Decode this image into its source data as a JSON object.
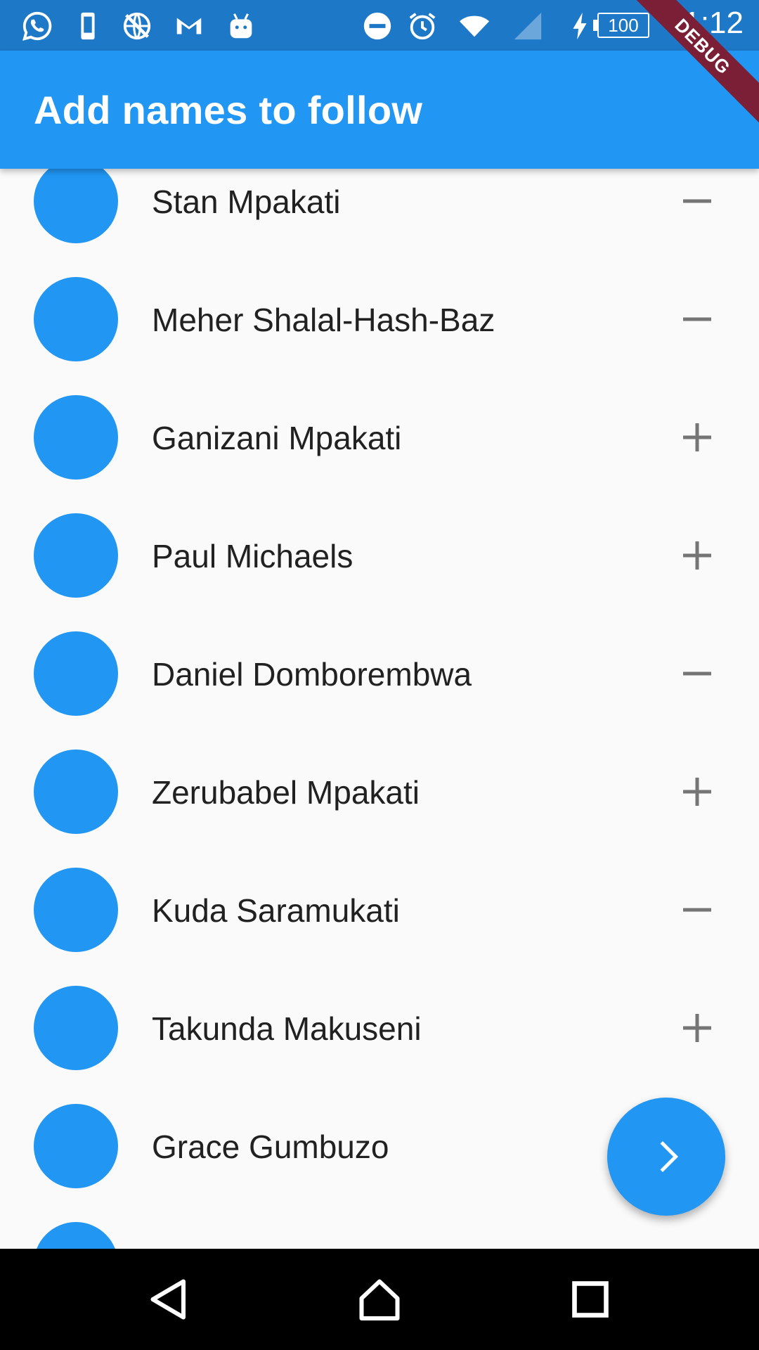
{
  "status_bar": {
    "time": "11:12",
    "battery": "100",
    "icons": [
      "whatsapp-icon",
      "phone-notification-icon",
      "no-network-icon",
      "gmail-icon",
      "android-icon",
      "do-not-disturb-icon",
      "alarm-icon",
      "wifi-icon",
      "cell-signal-icon",
      "charging-icon",
      "battery-icon"
    ]
  },
  "app_bar": {
    "title": "Add names to follow"
  },
  "debug_banner": "DEBUG",
  "list": {
    "items": [
      {
        "name": "Stan Mpakati",
        "action": "remove"
      },
      {
        "name": "Meher Shalal-Hash-Baz",
        "action": "remove"
      },
      {
        "name": "Ganizani Mpakati",
        "action": "add"
      },
      {
        "name": "Paul Michaels",
        "action": "add"
      },
      {
        "name": "Daniel Domborembwa",
        "action": "remove"
      },
      {
        "name": "Zerubabel Mpakati",
        "action": "add"
      },
      {
        "name": "Kuda Saramukati",
        "action": "remove"
      },
      {
        "name": "Takunda Makuseni",
        "action": "add"
      },
      {
        "name": "Grace Gumbuzo",
        "action": ""
      },
      {
        "name": "",
        "action": ""
      }
    ]
  },
  "fab": {
    "icon": "chevron-right-icon"
  },
  "nav_bar": {
    "buttons": [
      "back-icon",
      "home-icon",
      "recents-icon"
    ]
  },
  "colors": {
    "primary": "#2196f3",
    "status_bar": "#1e78c8",
    "background": "#fafafa",
    "icon_gray": "#757575"
  }
}
